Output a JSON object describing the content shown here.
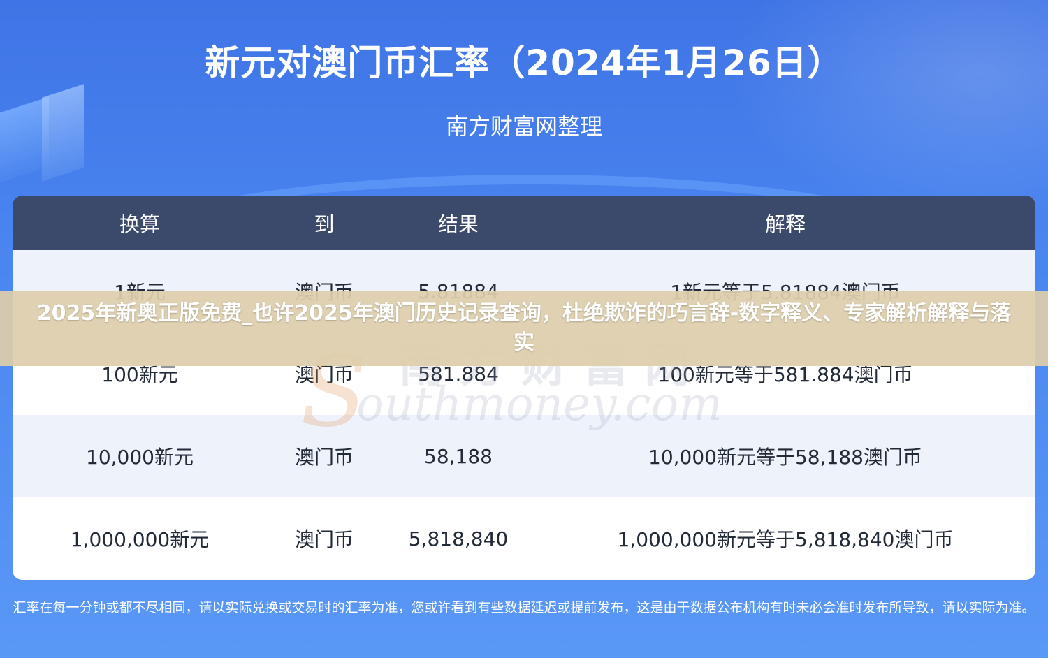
{
  "header": {
    "title": "新元对澳门币汇率（2024年1月26日）",
    "subtitle": "南方财富网整理"
  },
  "table": {
    "headers": [
      "换算",
      "到",
      "结果",
      "解释"
    ],
    "rows": [
      [
        "1新元",
        "澳门币",
        "5.81884",
        "1新元等于5.81884澳门币"
      ],
      [
        "100新元",
        "澳门币",
        "581.884",
        "100新元等于581.884澳门币"
      ],
      [
        "10,000新元",
        "澳门币",
        "58,188",
        "10,000新元等于58,188澳门币"
      ],
      [
        "1,000,000新元",
        "澳门币",
        "5,818,840",
        "1,000,000新元等于5,818,840澳门币"
      ]
    ]
  },
  "watermark": {
    "cn": "南方财富网",
    "en": "outhmoney.com",
    "s": "S"
  },
  "overlay": {
    "text": "2025年新奥正版免费_也许2025年澳门历史记录查询，杜绝欺诈的巧言辞-数字释义、专家解析解释与落实"
  },
  "footer": {
    "disclaimer": "汇率在每一分钟或都不尽相同，请以实际兑换或交易时的汇率为准，您或许看到有些数据延迟或提前发布，这是由于数据公布机构有时未必会准时发布所导致，请以实际为准。"
  }
}
